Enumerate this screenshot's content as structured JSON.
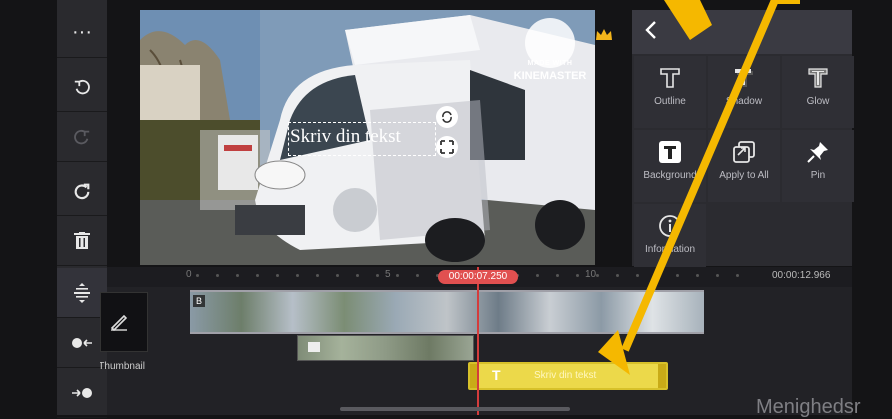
{
  "toolbar": {
    "items": [
      {
        "name": "more-icon",
        "glyph": "···"
      },
      {
        "name": "undo-icon",
        "glyph": "↶"
      },
      {
        "name": "redo-icon",
        "glyph": "↷"
      },
      {
        "name": "reset-icon",
        "glyph": "↺"
      },
      {
        "name": "delete-icon",
        "glyph": "🗑"
      },
      {
        "name": "split-layers-icon",
        "glyph": "≑"
      },
      {
        "name": "move-left-icon",
        "glyph": "●←"
      },
      {
        "name": "move-right-icon",
        "glyph": "→●"
      }
    ]
  },
  "preview": {
    "text_layer": "Skriv din tekst",
    "watermark_line1": "MADE WITH",
    "watermark_line2": "KINEMASTER",
    "premium_icon": "crown-icon"
  },
  "panel": {
    "back_icon": "chevron-left-icon",
    "items": [
      {
        "label": "Outline",
        "icon": "outline-icon"
      },
      {
        "label": "Shadow",
        "icon": "shadow-icon"
      },
      {
        "label": "Glow",
        "icon": "glow-icon"
      },
      {
        "label": "Background",
        "icon": "background-icon"
      },
      {
        "label": "Apply to All",
        "icon": "apply-all-icon"
      },
      {
        "label": "Pin",
        "icon": "pin-icon"
      },
      {
        "label": "Information",
        "icon": "info-icon"
      }
    ]
  },
  "timeline": {
    "playhead_time": "00:00:07.250",
    "total_time": "00:00:12.966",
    "ruler_labels": [
      "0",
      "5",
      "10"
    ],
    "thumbnail_label": "Thumbnail",
    "text_clip_label": "Skriv din tekst",
    "video_clip_icon": "clip-badge"
  },
  "overlay": {
    "corner_text": "Menighedsr",
    "accent": "#f5b800"
  }
}
